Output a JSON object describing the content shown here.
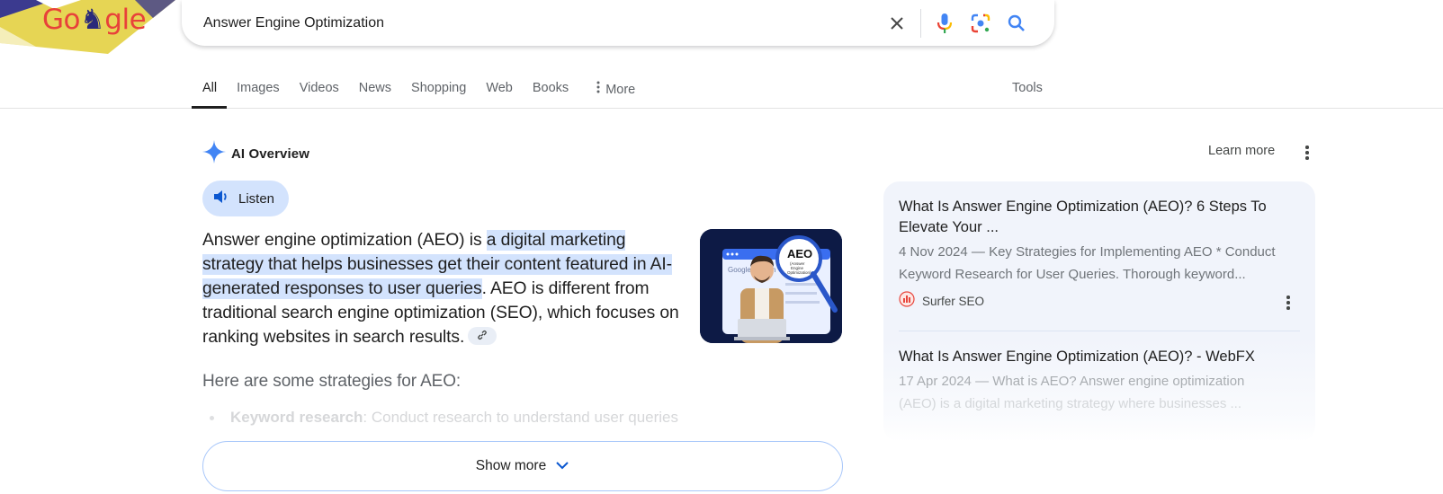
{
  "logo": {
    "text": "Go gle",
    "alt": "Google Doodle"
  },
  "search": {
    "query": "Answer Engine Optimization",
    "icons": [
      "clear-icon",
      "microphone-icon",
      "google-lens-icon",
      "search-icon"
    ]
  },
  "tabs": [
    {
      "label": "All",
      "active": true
    },
    {
      "label": "Images",
      "active": false
    },
    {
      "label": "Videos",
      "active": false
    },
    {
      "label": "News",
      "active": false
    },
    {
      "label": "Shopping",
      "active": false
    },
    {
      "label": "Web",
      "active": false
    },
    {
      "label": "Books",
      "active": false
    },
    {
      "label": "More",
      "active": false,
      "icon": "vertical-dots-icon"
    }
  ],
  "tools_label": "Tools",
  "ai_overview": {
    "title": "AI Overview",
    "learn_more": "Learn more",
    "listen_label": "Listen",
    "summary": {
      "before": "Answer engine optimization (AEO) is ",
      "highlight": "a digital marketing strategy that helps businesses get their content featured in AI-generated responses to user queries",
      "after": ". AEO is differ­ent from traditional search engine optimization (SEO), which focuses on ranking websites in search results."
    },
    "thumbnail_caption": "AEO (Answer Engine Optimization)",
    "strategies_heading": "Here are some strategies for AEO:",
    "bullets": [
      {
        "term": "Keyword research",
        "text": ": Conduct research to understand user queries"
      }
    ],
    "show_more_label": "Show more"
  },
  "sources": [
    {
      "title": "What Is Answer Engine Optimization (AEO)? 6 Steps To Elevate Your ...",
      "date": "4 Nov 2024",
      "snippet": "Key Strategies for Implementing AEO * Conduct Keyword Research for User Queries. Thorough keyword...",
      "site": "Surfer SEO"
    },
    {
      "title": "What Is Answer Engine Optimization (AEO)? - WebFX",
      "date": "17 Apr 2024",
      "snippet_line1": "What is AEO? Answer engine optimization",
      "snippet_line2": "(AEO) is a digital marketing strategy where businesses ..."
    }
  ],
  "colors": {
    "accent_blue": "#1a73e8",
    "highlight": "#d3e3fd",
    "panel_bg": "#f1f4fb",
    "logo_red": "#e8413a",
    "doodle_yellow": "#e6d554"
  }
}
